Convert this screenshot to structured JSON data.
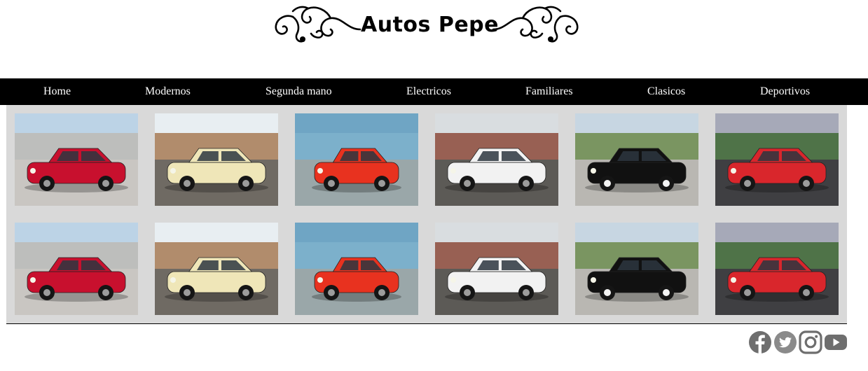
{
  "site": {
    "title": "Autos Pepe"
  },
  "nav": {
    "items": [
      {
        "label": "Home"
      },
      {
        "label": "Modernos"
      },
      {
        "label": "Segunda mano"
      },
      {
        "label": "Electricos"
      },
      {
        "label": "Familiares"
      },
      {
        "label": "Clasicos"
      },
      {
        "label": "Deportivos"
      }
    ]
  },
  "gallery": {
    "rows": 2,
    "cars": [
      {
        "icon": "red-mini-cooper-photo",
        "color": "#c8102e"
      },
      {
        "icon": "cream-fiat-147-photo",
        "color": "#efe6b8"
      },
      {
        "icon": "red-electric-microcar-photo",
        "color": "#e8321f"
      },
      {
        "icon": "white-ford-ka-photo",
        "color": "#f2f2f2"
      },
      {
        "icon": "black-classic-convertible-photo",
        "color": "#111111"
      },
      {
        "icon": "red-volkswagen-gol-photo",
        "color": "#d9262c"
      }
    ]
  },
  "social": [
    {
      "icon": "facebook-icon"
    },
    {
      "icon": "twitter-icon"
    },
    {
      "icon": "instagram-icon"
    },
    {
      "icon": "youtube-icon"
    }
  ],
  "colors": {
    "nav_background": "#000000",
    "gallery_background": "#d9d9d9",
    "social_icon": "#6e6e6e"
  }
}
